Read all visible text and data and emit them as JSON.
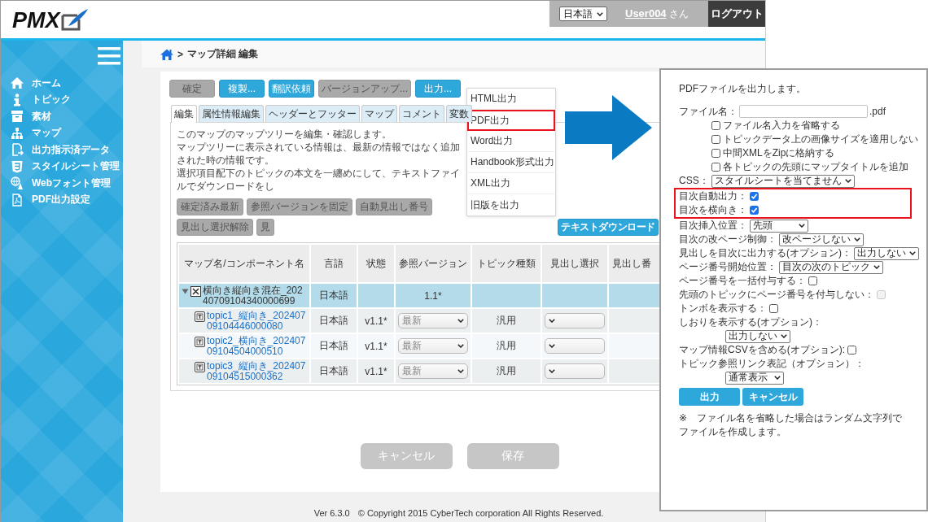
{
  "header": {
    "logo": "PMX",
    "language": "日本語",
    "user": "User004",
    "user_suffix": "さん",
    "logout": "ログアウト"
  },
  "sidebar": {
    "items": [
      {
        "label": "ホーム",
        "kind": "home"
      },
      {
        "label": "トピック",
        "kind": "info"
      },
      {
        "label": "素材",
        "kind": "box"
      },
      {
        "label": "マップ",
        "kind": "sitemap"
      },
      {
        "label": "出力指示済データ",
        "kind": "export"
      },
      {
        "label": "スタイルシート管理",
        "kind": "css"
      },
      {
        "label": "Webフォント管理",
        "kind": "font"
      },
      {
        "label": "PDF出力設定",
        "kind": "pdf"
      }
    ]
  },
  "breadcrumb": {
    "separator": ">",
    "current": "マップ詳細 編集"
  },
  "toolbar": [
    {
      "label": "確定",
      "disabled": true
    },
    {
      "label": "複製...",
      "disabled": false
    },
    {
      "label": "翻訳依頼",
      "disabled": false
    },
    {
      "label": "バージョンアップ...",
      "disabled": true
    },
    {
      "label": "出力...",
      "disabled": false
    }
  ],
  "tabs": [
    {
      "label": "編集",
      "selected": true
    },
    {
      "label": "属性情報編集",
      "selected": false
    },
    {
      "label": "ヘッダーとフッター",
      "selected": false
    },
    {
      "label": "マップ",
      "selected": false
    },
    {
      "label": "コメント",
      "selected": false
    },
    {
      "label": "変数",
      "selected": false
    }
  ],
  "description": [
    "このマップのマップツリーを編集・確認します。",
    "マップツリーに表示されている情報は、最新の情報ではなく追加された時の情報です。",
    "選択項目配下のトピックの本文を一纏めにして、テキストファイルでダウンロードをし"
  ],
  "actions": [
    {
      "label": "確定済み最新",
      "disabled": true
    },
    {
      "label": "参照バージョンを固定",
      "disabled": true
    },
    {
      "label": "自動見出し番号",
      "disabled": true
    },
    {
      "label": "見出し選択解除",
      "disabled": true
    },
    {
      "label": "見",
      "disabled": true
    },
    {
      "label": "テキストダウンロード",
      "disabled": false
    }
  ],
  "table": {
    "columns": [
      "マップ名/コンポーネント名",
      "言語",
      "状態",
      "参照バージョン",
      "トピック種類",
      "見出し選択",
      "見出し番"
    ],
    "rows": [
      {
        "kind": "map",
        "selected": true,
        "expanded": true,
        "name": "横向き縦向き混在_20240709104340000699",
        "language": "日本語",
        "version": "1.1*"
      },
      {
        "kind": "topic",
        "selected": false,
        "name": "topic1_縦向き_20240709104446000080",
        "language": "日本語",
        "status": "v1.1*",
        "version": "最新",
        "type": "汎用"
      },
      {
        "kind": "topic",
        "selected": false,
        "name": "topic2_横向き_20240709104504000510",
        "language": "日本語",
        "status": "v1.1*",
        "version": "最新",
        "type": "汎用"
      },
      {
        "kind": "topic",
        "selected": false,
        "name": "topic3_縦向き_20240709104515000362",
        "language": "日本語",
        "status": "v1.1*",
        "version": "最新",
        "type": "汎用"
      }
    ]
  },
  "form_buttons": [
    {
      "label": "キャンセル",
      "disabled": true
    },
    {
      "label": "保存",
      "disabled": true
    }
  ],
  "footer": {
    "version": "Ver 6.3.0",
    "copyright": "© Copyright 2015 CyberTech corporation All Rights Reserved."
  },
  "output_menu": [
    {
      "label": "HTML出力",
      "callout": false
    },
    {
      "label": "PDF出力",
      "callout": true
    },
    {
      "label": "Word出力",
      "callout": false
    },
    {
      "label": "Handbook形式出力",
      "callout": false
    },
    {
      "label": "XML出力",
      "callout": false
    },
    {
      "label": "旧版を出力",
      "callout": false
    }
  ],
  "pdf_dialog": {
    "intro": "PDFファイルを出力します。",
    "filename": {
      "label": "ファイル名：",
      "suffix": ".pdf"
    },
    "filename_options": [
      {
        "label": "ファイル名入力を省略する",
        "checked": false
      },
      {
        "label": "トピックデータ上の画像サイズを適用しない",
        "checked": false
      },
      {
        "label": "中間XMLをZipに格納する",
        "checked": false
      },
      {
        "label": "各トピックの先頭にマップタイトルを追加",
        "checked": false
      }
    ],
    "fields": [
      {
        "kind": "select",
        "label": "CSS：",
        "value": "スタイルシートを当てません"
      },
      {
        "kind": "group",
        "highlighted": true,
        "fields": [
          {
            "kind": "checkbox",
            "label": "目次自動出力：",
            "checked": true,
            "disabled": false
          },
          {
            "kind": "checkbox",
            "label": "目次を横向き：",
            "checked": true,
            "disabled": false
          }
        ]
      },
      {
        "kind": "select",
        "label": "目次挿入位置：",
        "value": "先頭"
      },
      {
        "kind": "select",
        "label": "目次の改ページ制御：",
        "value": "改ページしない"
      },
      {
        "kind": "select",
        "label": "見出しを目次に出力する(オプション)：",
        "value": "出力しない"
      },
      {
        "kind": "select",
        "label": "ページ番号開始位置：",
        "value": "目次の次のトピック"
      },
      {
        "kind": "checkbox",
        "label": "ページ番号を一括付与する：",
        "checked": false,
        "disabled": false
      },
      {
        "kind": "checkbox",
        "label": "先頭のトピックにページ番号を付与しない：",
        "checked": false,
        "disabled": true
      },
      {
        "kind": "checkbox",
        "label": "トンボを表示する：",
        "checked": false,
        "disabled": false
      },
      {
        "kind": "select-below",
        "label": "しおりを表示する(オプション)：",
        "value": "出力しない"
      },
      {
        "kind": "checkbox",
        "label": "マップ情報CSVを含める(オプション):",
        "checked": false,
        "disabled": false
      },
      {
        "kind": "select-below",
        "label": "トピック参照リンク表記（オプション）：",
        "value": "通常表示"
      }
    ],
    "buttons": [
      "出力",
      "キャンセル"
    ],
    "note": "※　ファイル名を省略した場合はランダム文字列でファイルを作成します。"
  }
}
